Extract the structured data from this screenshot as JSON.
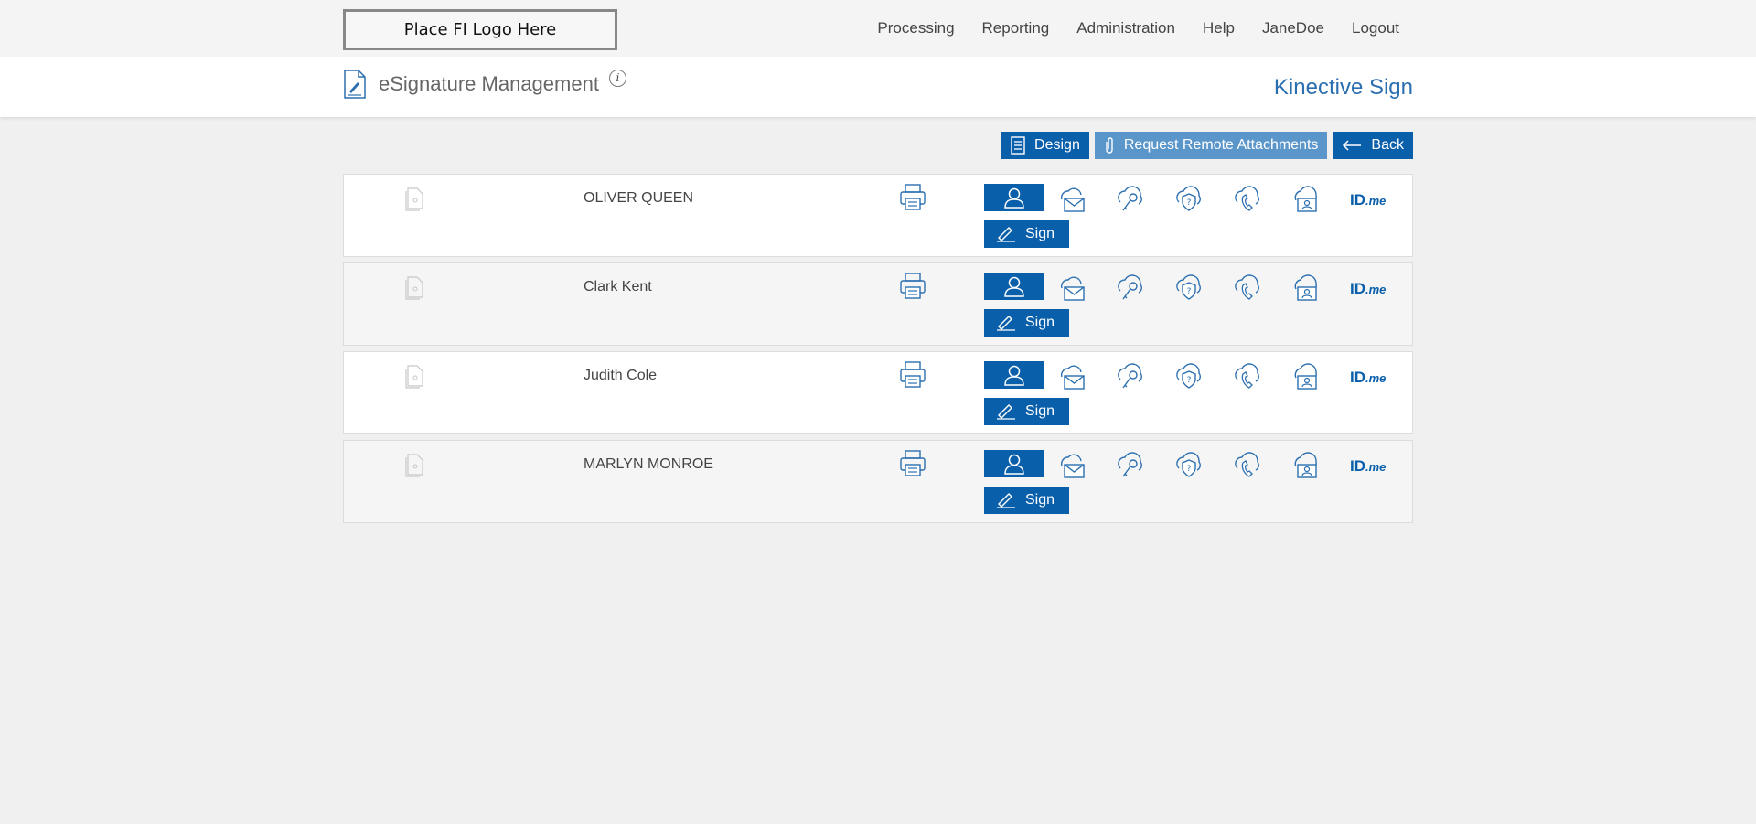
{
  "header": {
    "logo_text": "Place FI Logo Here",
    "nav": [
      "Processing",
      "Reporting",
      "Administration",
      "Help",
      "JaneDoe",
      "Logout"
    ]
  },
  "titlebar": {
    "title": "eSignature Management",
    "info": "i",
    "brand": "Kinective Sign"
  },
  "actions": {
    "design": "Design",
    "request_attachments": "Request Remote Attachments",
    "back": "Back"
  },
  "signers": [
    {
      "name": "OLIVER QUEEN",
      "sign_label": "Sign"
    },
    {
      "name": "Clark Kent",
      "sign_label": "Sign"
    },
    {
      "name": "Judith Cole",
      "sign_label": "Sign"
    },
    {
      "name": "MARLYN MONROE",
      "sign_label": "Sign"
    }
  ],
  "idme": {
    "main": "ID",
    "suffix": ".me"
  },
  "colors": {
    "accent": "#0a5fab",
    "accent_light": "#5b96cb",
    "brand": "#2b6fb0"
  },
  "row_icons": [
    "email-cloud-icon",
    "key-cloud-icon",
    "question-shield-cloud-icon",
    "phone-cloud-icon",
    "id-card-cloud-icon",
    "idme-icon"
  ]
}
